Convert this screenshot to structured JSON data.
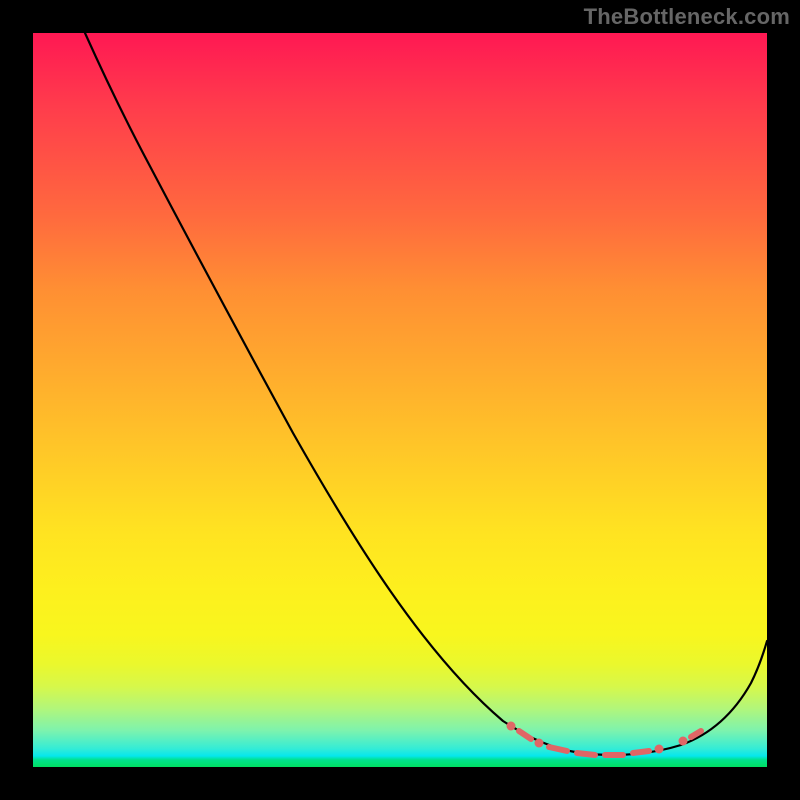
{
  "attribution": "TheBottleneck.com",
  "colors": {
    "frame_bg": "#000000",
    "curve": "#000000",
    "marker": "#e06666",
    "gradient_top": "#ff1853",
    "gradient_mid": "#ffe321",
    "gradient_bottom": "#00df63"
  },
  "chart_data": {
    "type": "line",
    "title": "",
    "xlabel": "",
    "ylabel": "",
    "xlim": [
      0,
      100
    ],
    "ylim": [
      0,
      100
    ],
    "grid": false,
    "legend": false,
    "background": "vertical-gradient red→yellow→green (bottleneck severity)",
    "series": [
      {
        "name": "bottleneck_curve",
        "x": [
          7,
          12,
          18,
          25,
          35,
          45,
          55,
          63,
          70,
          75,
          80,
          85,
          90,
          95,
          100
        ],
        "values": [
          100,
          92,
          84,
          72,
          55,
          40,
          25,
          14,
          8,
          4,
          2,
          2,
          4,
          10,
          18
        ]
      }
    ],
    "annotations": [
      {
        "name": "optimal_range_marker",
        "style": "salmon-dashed",
        "x_range": [
          65,
          91
        ],
        "y_approx": 3
      }
    ]
  }
}
